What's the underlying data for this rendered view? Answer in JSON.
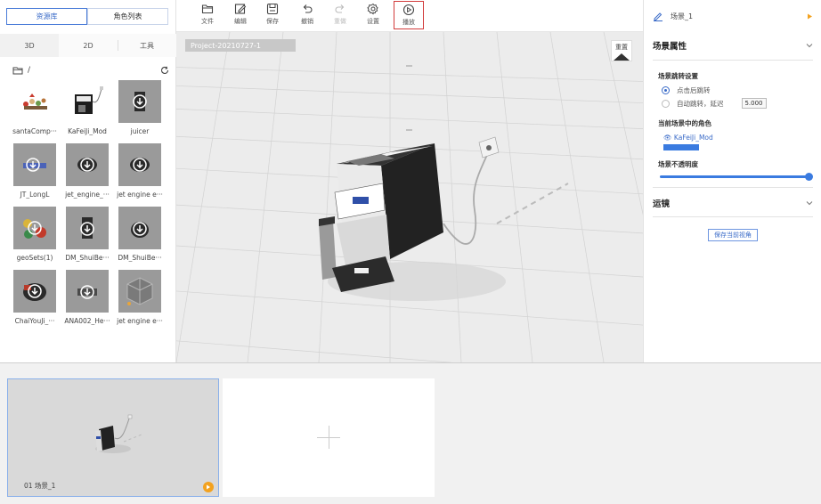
{
  "left_panel": {
    "tabs": [
      "资源库",
      "角色列表"
    ],
    "subtabs": [
      "3D",
      "2D",
      "工具"
    ],
    "path": "/",
    "assets": [
      {
        "name": "santaComp···",
        "icon": "santa-model-icon"
      },
      {
        "name": "KaFeiJi_Mod",
        "icon": "coffee-machine-icon"
      },
      {
        "name": "juicer",
        "icon": "download-icon"
      },
      {
        "name": "JT_LongL",
        "icon": "download-icon"
      },
      {
        "name": "jet_engine_···",
        "icon": "download-icon"
      },
      {
        "name": "jet engine e···",
        "icon": "download-icon"
      },
      {
        "name": "geoSets(1)",
        "icon": "download-icon"
      },
      {
        "name": "DM_ShuiBe···",
        "icon": "download-icon"
      },
      {
        "name": "DM_ShuiBe···",
        "icon": "download-icon"
      },
      {
        "name": "ChaiYouJi_···",
        "icon": "download-icon"
      },
      {
        "name": "ANA002_He···",
        "icon": "download-icon"
      },
      {
        "name": "jet engine e···",
        "icon": "cube-icon"
      }
    ]
  },
  "toolbar": {
    "file": "文件",
    "edit": "编辑",
    "save": "保存",
    "undo": "撤销",
    "redo": "重做",
    "settings": "设置",
    "play": "播放"
  },
  "viewport": {
    "project_label": "Project-20210727-1",
    "reset_label": "重置"
  },
  "right_panel": {
    "scene_name": "场景_1",
    "scene_props_title": "场景属性",
    "jump_setting_title": "场景跳转设置",
    "jump_click": "点击后跳转",
    "jump_auto": "自动跳转，延迟",
    "delay_value": "5.000",
    "roles_title": "当前场景中的角色",
    "role_name": "KaFeiJi_Mod",
    "opacity_title": "场景不透明度",
    "opacity_value": 1.0,
    "camera_title": "运镜",
    "save_view_label": "保存当前视角"
  },
  "bottom": {
    "scene_card_label": "01 场景_1"
  },
  "colors": {
    "accent": "#3a6bc8",
    "play_highlight": "#d23b3b",
    "play_badge": "#f3a21f"
  }
}
